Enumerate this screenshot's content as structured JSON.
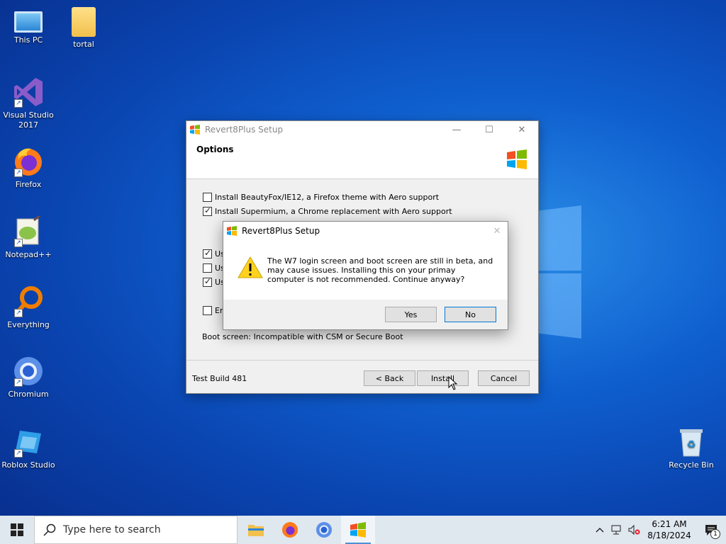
{
  "desktop": {
    "icons": [
      {
        "label": "This PC"
      },
      {
        "label": "tortal"
      },
      {
        "label": "Visual Studio 2017"
      },
      {
        "label": "Firefox"
      },
      {
        "label": "Notepad++"
      },
      {
        "label": "Everything"
      },
      {
        "label": "Chromium"
      },
      {
        "label": "Roblox Studio"
      },
      {
        "label": "Recycle Bin"
      }
    ]
  },
  "setup_window": {
    "title": "Revert8Plus Setup",
    "header_title": "Options",
    "options": [
      {
        "label": "Install BeautyFox/IE12, a Firefox theme with Aero support",
        "checked": false
      },
      {
        "label": "Install Supermium, a Chrome replacement with Aero support",
        "checked": true
      },
      {
        "label": "Us",
        "checked": true
      },
      {
        "label": "Us",
        "checked": false
      },
      {
        "label": "Us",
        "checked": true
      },
      {
        "label": "En",
        "checked": false
      }
    ],
    "boot_note": "Boot screen: Incompatible with CSM or Secure Boot",
    "build_label": "Test Build 481",
    "back_button": "< Back",
    "install_button": "Install",
    "cancel_button": "Cancel"
  },
  "dialog": {
    "title": "Revert8Plus Setup",
    "message": "The W7 login screen and boot screen are still in beta, and may cause issues. Installing this on your primay computer is not recommended. Continue anyway?",
    "yes_button": "Yes",
    "no_button": "No"
  },
  "taskbar": {
    "search_placeholder": "Type here to search",
    "clock_time": "6:21 AM",
    "clock_date": "8/18/2024",
    "notification_count": "1"
  },
  "colors": {
    "accent": "#0078d7",
    "taskbar": "#dfe7ef"
  }
}
